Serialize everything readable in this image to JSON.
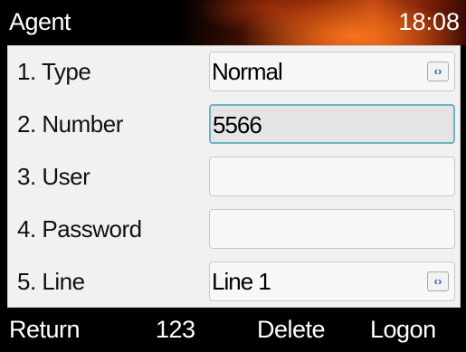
{
  "header": {
    "title": "Agent",
    "clock": "18:08"
  },
  "form": {
    "rows": [
      {
        "label": "1. Type",
        "value": "Normal",
        "has_switch": true
      },
      {
        "label": "2. Number",
        "value": "5566",
        "focused": true
      },
      {
        "label": "3. User",
        "value": ""
      },
      {
        "label": "4. Password",
        "value": ""
      },
      {
        "label": "5. Line",
        "value": "Line 1",
        "has_switch": true
      }
    ]
  },
  "softkeys": {
    "return": "Return",
    "input_mode": "123",
    "delete": "Delete",
    "logon": "Logon"
  },
  "colors": {
    "focus_border": "#6fb3c7",
    "switch_arrow": "#2a57b8",
    "header_accent": "#c14a12"
  },
  "icons": {
    "switch": "left-right-arrows-icon"
  }
}
